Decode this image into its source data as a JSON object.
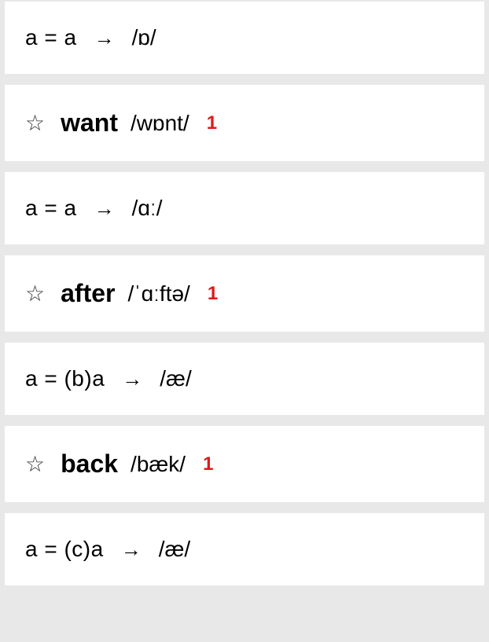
{
  "rules": [
    {
      "lhs": "a = a",
      "rhs": "/ɒ/"
    },
    {
      "lhs": "a = a",
      "rhs": "/ɑː/"
    },
    {
      "lhs": "a = (b)a",
      "rhs": "/æ/"
    },
    {
      "lhs": "a = (c)a",
      "rhs": "/æ/"
    }
  ],
  "words": [
    {
      "text": "want",
      "pron": "/wɒnt/",
      "count": "1"
    },
    {
      "text": "after",
      "pron": "/ˈɑːftə/",
      "count": "1"
    },
    {
      "text": "back",
      "pron": "/bæk/",
      "count": "1"
    }
  ],
  "arrow": "→"
}
